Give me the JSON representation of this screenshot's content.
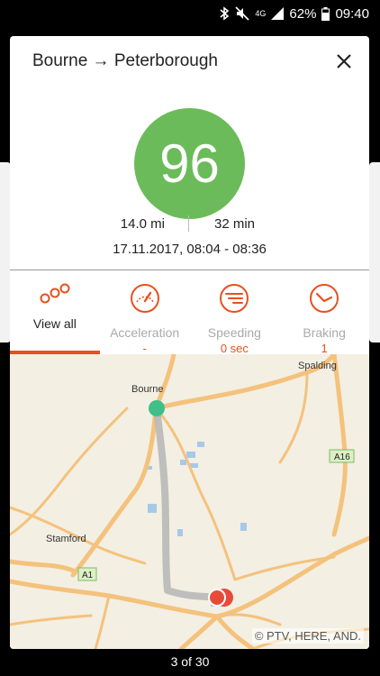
{
  "status_bar": {
    "network": "4G",
    "battery": "62%",
    "time": "09:40"
  },
  "trip": {
    "title": "Bourne → Peterborough",
    "score": "96",
    "distance": "14.0 mi",
    "duration": "32 min",
    "datetime": "17.11.2017, 08:04 - 08:36"
  },
  "tabs": [
    {
      "label": "View all",
      "value": "",
      "icon": "dots-icon",
      "active": true
    },
    {
      "label": "Acceleration",
      "value": "-",
      "icon": "speedometer-icon",
      "active": false
    },
    {
      "label": "Speeding",
      "value": "0 sec",
      "icon": "speeding-icon",
      "active": false
    },
    {
      "label": "Braking",
      "value": "1",
      "icon": "braking-icon",
      "active": false
    }
  ],
  "map": {
    "places": {
      "bourne": "Bourne",
      "spalding": "Spalding",
      "stamford": "Stamford"
    },
    "roads": {
      "a1": "A1",
      "a16": "A16"
    },
    "copyright": "© PTV, HERE, AND."
  },
  "pager": "3 of 30",
  "colors": {
    "accent": "#e8501f",
    "score_bg": "#6cbb5a",
    "start_marker": "#3fbf8a",
    "end_marker": "#e84a3a"
  }
}
